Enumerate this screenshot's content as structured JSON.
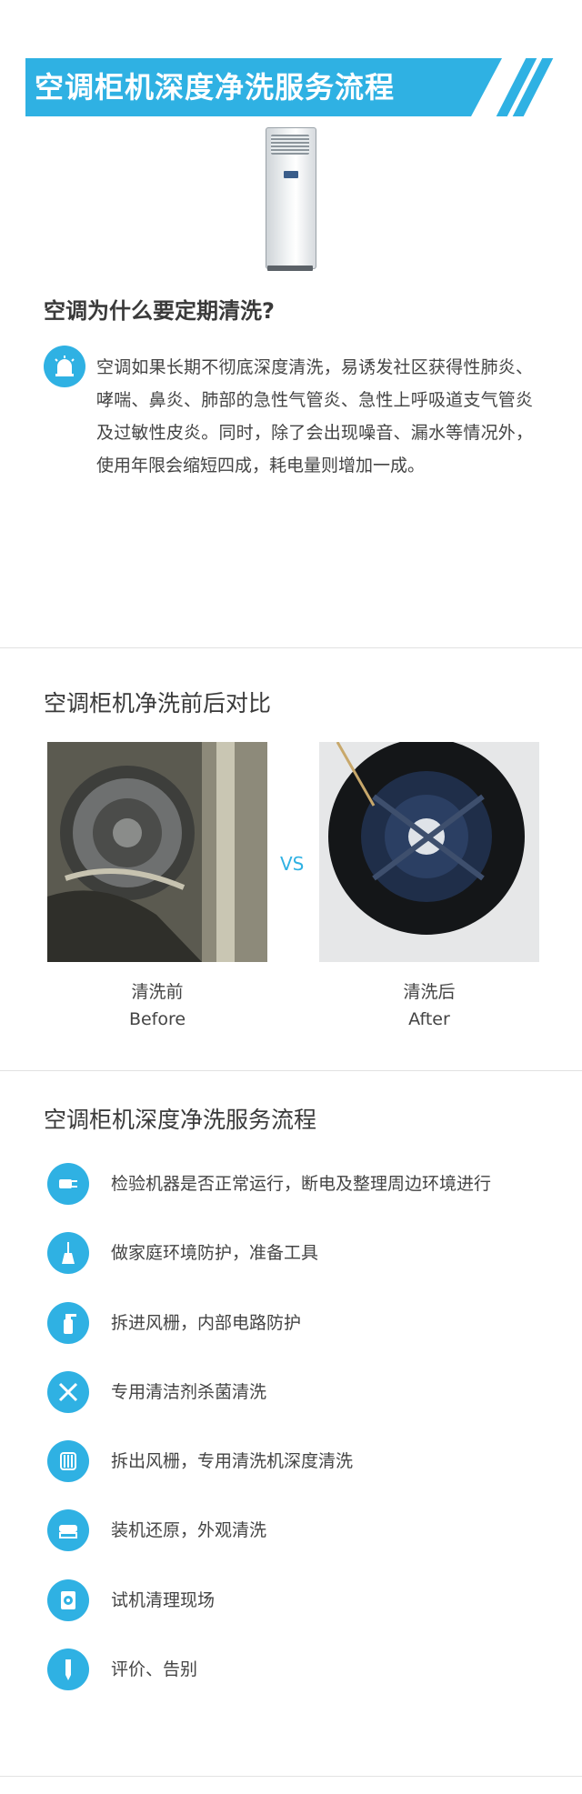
{
  "banner": {
    "title": "空调柜机深度净洗服务流程",
    "color": "#2fb1e3"
  },
  "why": {
    "heading": "空调为什么要定期清洗?",
    "icon": "alarm-icon",
    "text": "空调如果长期不彻底深度清洗，易诱发社区获得性肺炎、哮喘、鼻炎、肺部的急性气管炎、急性上呼吸道支气管炎及过敏性皮炎。同时，除了会出现噪音、漏水等情况外，使用年限会缩短四成，耗电量则增加一成。"
  },
  "compare": {
    "heading": "空调柜机净洗前后对比",
    "vs": "VS",
    "before": {
      "cn": "清洗前",
      "en": "Before"
    },
    "after": {
      "cn": "清洗后",
      "en": "After"
    }
  },
  "process": {
    "heading": "空调柜机深度净洗服务流程",
    "steps": [
      {
        "icon": "power-plug-icon",
        "text": "检验机器是否正常运行，断电及整理周边环境进行"
      },
      {
        "icon": "broom-icon",
        "text": "做家庭环境防护，准备工具"
      },
      {
        "icon": "spray-bottle-icon",
        "text": "拆进风栅，内部电路防护"
      },
      {
        "icon": "wrench-screwdriver-icon",
        "text": "专用清洁剂杀菌清洗"
      },
      {
        "icon": "filter-coil-icon",
        "text": "拆出风栅，专用清洗机深度清洗"
      },
      {
        "icon": "cleaning-brush-icon",
        "text": "装机还原，外观清洗"
      },
      {
        "icon": "disk-check-icon",
        "text": "试机清理现场"
      },
      {
        "icon": "pen-icon",
        "text": "评价、告别"
      }
    ]
  }
}
